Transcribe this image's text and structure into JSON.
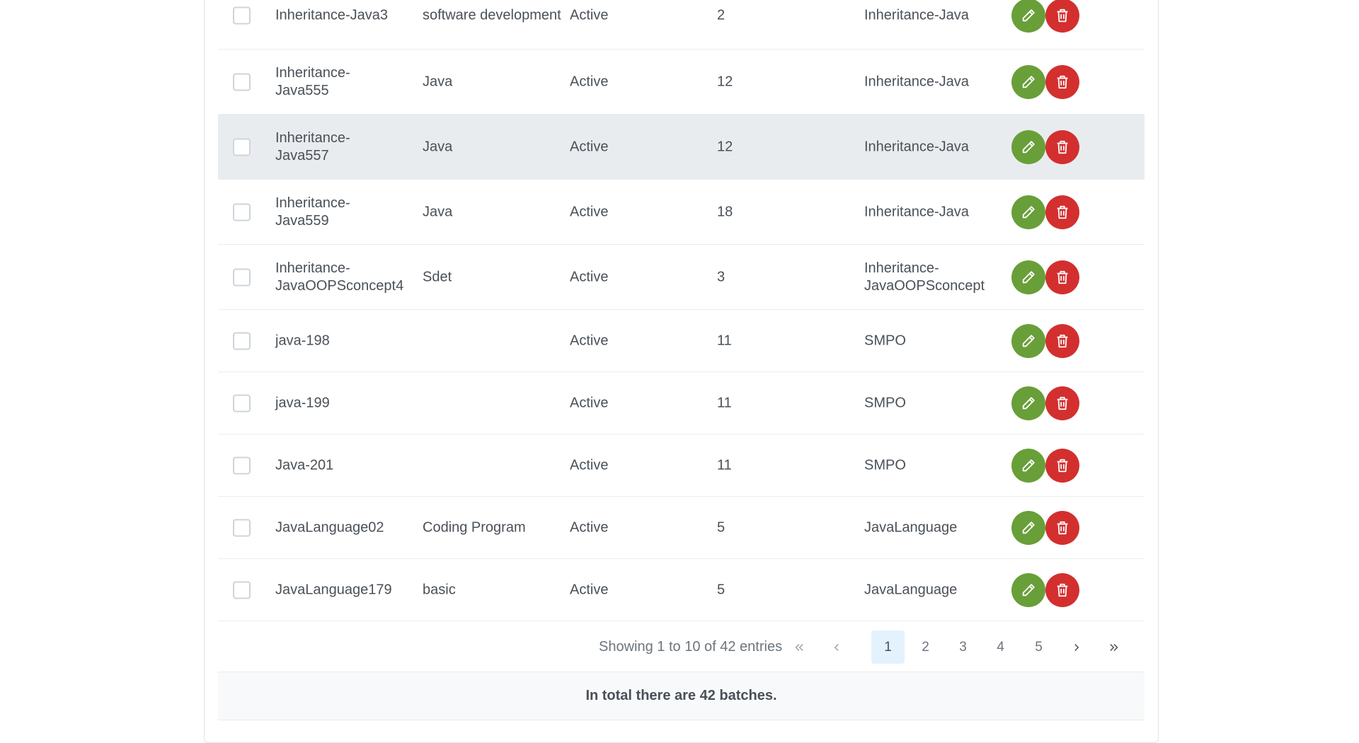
{
  "rows": [
    {
      "name": "Inheritance-Java3",
      "description": "software development",
      "status": "Active",
      "classes": "2",
      "program": "Inheritance-Java"
    },
    {
      "name": "Inheritance-Java555",
      "description": "Java",
      "status": "Active",
      "classes": "12",
      "program": "Inheritance-Java"
    },
    {
      "name": "Inheritance-Java557",
      "description": "Java",
      "status": "Active",
      "classes": "12",
      "program": "Inheritance-Java"
    },
    {
      "name": "Inheritance-Java559",
      "description": "Java",
      "status": "Active",
      "classes": "18",
      "program": "Inheritance-Java"
    },
    {
      "name": "Inheritance-JavaOOPSconcept4",
      "description": "Sdet",
      "status": "Active",
      "classes": "3",
      "program": "Inheritance-JavaOOPSconcept"
    },
    {
      "name": "java-198",
      "description": "",
      "status": "Active",
      "classes": "11",
      "program": "SMPO"
    },
    {
      "name": "java-199",
      "description": "",
      "status": "Active",
      "classes": "11",
      "program": "SMPO"
    },
    {
      "name": "Java-201",
      "description": "",
      "status": "Active",
      "classes": "11",
      "program": "SMPO"
    },
    {
      "name": "JavaLanguage02",
      "description": "Coding Program",
      "status": "Active",
      "classes": "5",
      "program": "JavaLanguage"
    },
    {
      "name": "JavaLanguage179",
      "description": "basic",
      "status": "Active",
      "classes": "5",
      "program": "JavaLanguage"
    }
  ],
  "paginator": {
    "report": "Showing 1 to 10 of 42 entries",
    "pages": [
      "1",
      "2",
      "3",
      "4",
      "5"
    ],
    "current_page": "1"
  },
  "footer": {
    "summary": "In total there are 42 batches."
  },
  "colors": {
    "edit": "#689f38",
    "delete": "#d32f2f",
    "highlight_row": "#e9ecef",
    "active_page": "#e3f2fd"
  },
  "icons": {
    "edit": "pencil-icon",
    "delete": "trash-icon",
    "first": "double-chevron-left-icon",
    "prev": "chevron-left-icon",
    "next": "chevron-right-icon",
    "last": "double-chevron-right-icon"
  }
}
